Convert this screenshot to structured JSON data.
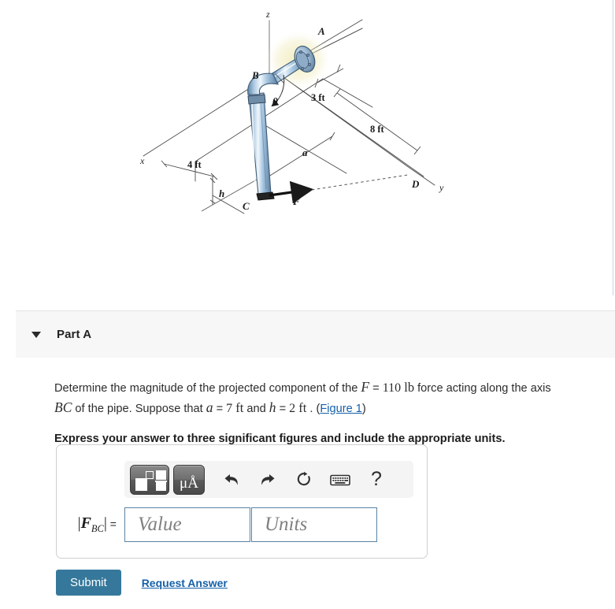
{
  "figure": {
    "alt_name": "pipe-assembly-3d-diagram",
    "axis_labels": {
      "x": "x",
      "y": "y",
      "z": "z"
    },
    "point_labels": [
      "A",
      "B",
      "C",
      "D",
      "F"
    ],
    "dimension_labels": [
      "3 ft",
      "8 ft",
      "4 ft",
      "a",
      "h"
    ],
    "angle_label": "θ",
    "colors": {
      "pipe_fill": "#a9c8e2",
      "pipe_edge": "#3f5a74",
      "line": "#4a4a4a"
    }
  },
  "part": {
    "caret_icon": "triangle-down-icon",
    "title": "Part A"
  },
  "question": {
    "line1_a": "Determine the magnitude of the projected component of the ",
    "F_symbol": "F",
    "eq1": " = ",
    "F_value": "110",
    "F_unit": "lb",
    "line1_b": " force acting along the axis",
    "BC_symbol": "BC",
    "line2_a": " of the pipe. Suppose that ",
    "a_symbol": "a",
    "a_value": "7",
    "a_unit": "ft",
    "line2_b": " and ",
    "h_symbol": "h",
    "h_value": "2",
    "h_unit": "ft",
    "line2_c": " . (",
    "figure_link": "Figure 1",
    "line2_d": ")",
    "instruction": "Express your answer to three significant figures and include the appropriate units."
  },
  "toolbar": {
    "template_button": "template-icon",
    "units_button": "μÅ",
    "undo": "undo-icon",
    "redo": "redo-icon",
    "reset": "reset-icon",
    "keyboard": "keyboard-icon",
    "help": "?"
  },
  "answer": {
    "label_abs_open": "|",
    "label_F": "F",
    "label_sub": "BC",
    "label_abs_close": "|",
    "label_eq": " =",
    "value_placeholder": "Value",
    "units_placeholder": "Units",
    "value_text": "",
    "units_text": ""
  },
  "actions": {
    "submit_label": "Submit",
    "request_answer_label": "Request Answer",
    "submit_color": "#36789b",
    "link_color": "#1560a8"
  }
}
